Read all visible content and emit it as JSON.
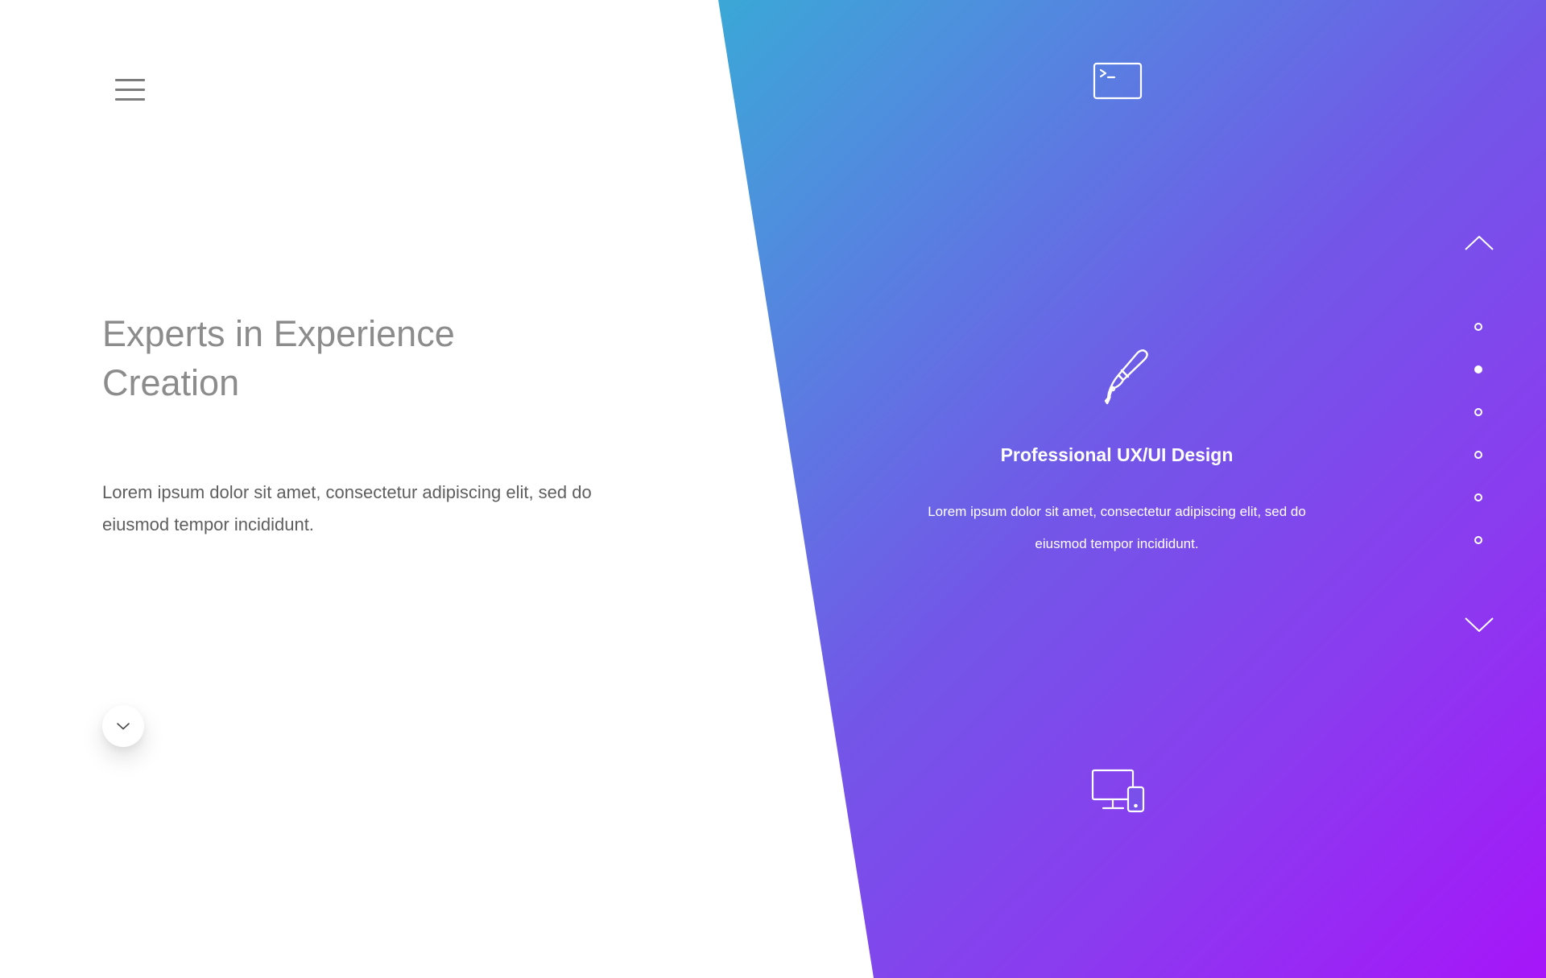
{
  "header": {
    "menu_icon": "hamburger-menu-icon"
  },
  "hero": {
    "title_line1": "Experts in Experience",
    "title_line2": "Creation",
    "text_line1": "Lorem ipsum dolor sit amet, consectetur adipiscing elit, sed do",
    "text_line2": "eiusmod tempor incididunt.",
    "scroll_icon": "chevron-down-icon"
  },
  "services": {
    "top_icon": "terminal-icon",
    "current": {
      "icon": "brush-icon",
      "title": "Professional UX/UI Design",
      "text_line1": "Lorem ipsum dolor sit amet, consectetur adipiscing elit, sed do",
      "text_line2": "eiusmod tempor incididunt."
    },
    "bottom_icon": "devices-icon"
  },
  "slider_nav": {
    "up_icon": "chevron-up-icon",
    "down_icon": "chevron-down-icon",
    "dot_count": 6,
    "active_index": 1
  },
  "colors": {
    "gradient_start": "#06f2b8",
    "gradient_end": "#a615f9",
    "title_gray": "#8c8c8c",
    "text_gray": "#5e5e5e"
  }
}
